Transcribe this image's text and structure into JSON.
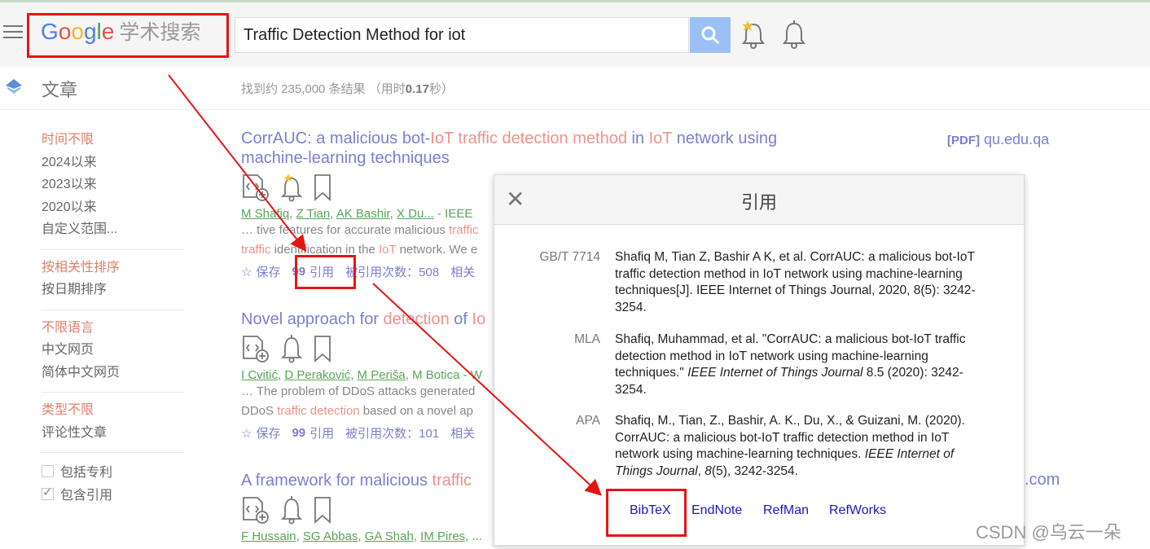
{
  "header": {
    "logo_word": "Google",
    "logo_suffix": "学术搜索",
    "search_value": "Traffic Detection Method for iot",
    "menu_icon": "hamburger-menu-icon",
    "search_icon": "search-icon",
    "alert_icon": "bell-star-icon",
    "notify_icon": "bell-icon"
  },
  "subheader": {
    "section": "文章",
    "result_count_prefix": "找到约 235,000 条结果",
    "result_time_pre": "（用时",
    "result_time_value": "0.17",
    "result_time_post": "秒）"
  },
  "sidebar": {
    "time": [
      "时间不限",
      "2024以来",
      "2023以来",
      "2020以来",
      "自定义范围..."
    ],
    "sort": [
      "按相关性排序",
      "按日期排序"
    ],
    "lang": [
      "不限语言",
      "中文网页",
      "简体中文网页"
    ],
    "type": [
      "类型不限",
      "评论性文章"
    ],
    "checks": [
      {
        "label": "包括专利",
        "checked": false
      },
      {
        "label": "包含引用",
        "checked": true
      }
    ]
  },
  "results": [
    {
      "title_parts": [
        "CorrAUC: a malicious bot-",
        "IoT",
        " ",
        "traffic detection method",
        " in ",
        "IoT",
        " network using machine-learning techniques"
      ],
      "authors": [
        "M Shafiq",
        "Z Tian",
        "AK Bashir",
        "X Du..."
      ],
      "authors_suffix": " - IEEE",
      "snippet_line1_parts": [
        "… tive features for accurate malicious ",
        "traffic"
      ],
      "snippet_line2_parts": [
        "traffic",
        " identification in the ",
        "IoT",
        " network. We e"
      ],
      "save": "保存",
      "cite": "引用",
      "cited_by": "被引用次数：508",
      "related": "相关"
    },
    {
      "title_parts": [
        "Novel approach for ",
        "detection",
        " of ",
        "Io"
      ],
      "authors": [
        "I Cvitić",
        "D Peraković",
        "M Periša"
      ],
      "authors_suffix": ", M Botica - W",
      "snippet_line1_parts": [
        "… The problem of DDoS attacks generated"
      ],
      "snippet_line2_parts": [
        "DDoS ",
        "traffic detection",
        " based on a novel ap"
      ],
      "save": "保存",
      "cite": "引用",
      "cited_by": "被引用次数：101",
      "related": "相关"
    },
    {
      "title_parts": [
        "A framework for malicious ",
        "traffic",
        " "
      ],
      "authors": [
        "F Hussain",
        "SG Abbas",
        "GA Shah",
        "IM Pires"
      ],
      "authors_suffix": ", ...",
      "snippet_line1_parts": [
        ""
      ],
      "snippet_line2_parts": [
        ""
      ],
      "save": "",
      "cite": "",
      "cited_by": "",
      "related": ""
    }
  ],
  "pdf_link": {
    "tag": "[PDF]",
    "domain": "qu.edu.qa"
  },
  "third_result_domain_end": ".com",
  "dialog": {
    "title": "引用",
    "close": "✕",
    "citations": [
      {
        "style": "GB/T 7714",
        "text": "Shafiq M, Tian Z, Bashir A K, et al. CorrAUC: a malicious bot-IoT traffic detection method in IoT network using machine-learning techniques[J]. IEEE Internet of Things Journal, 2020, 8(5): 3242-3254."
      },
      {
        "style": "MLA",
        "text_pre": "Shafiq, Muhammad, et al. \"CorrAUC: a malicious bot-IoT traffic detection method in IoT network using machine-learning techniques.\" ",
        "text_em": "IEEE Internet of Things Journal",
        "text_post": " 8.5 (2020): 3242-3254."
      },
      {
        "style": "APA",
        "text_pre": "Shafiq, M., Tian, Z., Bashir, A. K., Du, X., & Guizani, M. (2020). CorrAUC: a malicious bot-IoT traffic detection method in IoT network using machine-learning techniques. ",
        "text_em": "IEEE Internet of Things Journal",
        "text_mid": ", ",
        "text_em2": "8",
        "text_post": "(5), 3242-3254."
      }
    ],
    "exports": [
      "BibTeX",
      "EndNote",
      "RefMan",
      "RefWorks"
    ]
  },
  "watermark": "CSDN @乌云一朵",
  "annotation_color": "#e61515"
}
